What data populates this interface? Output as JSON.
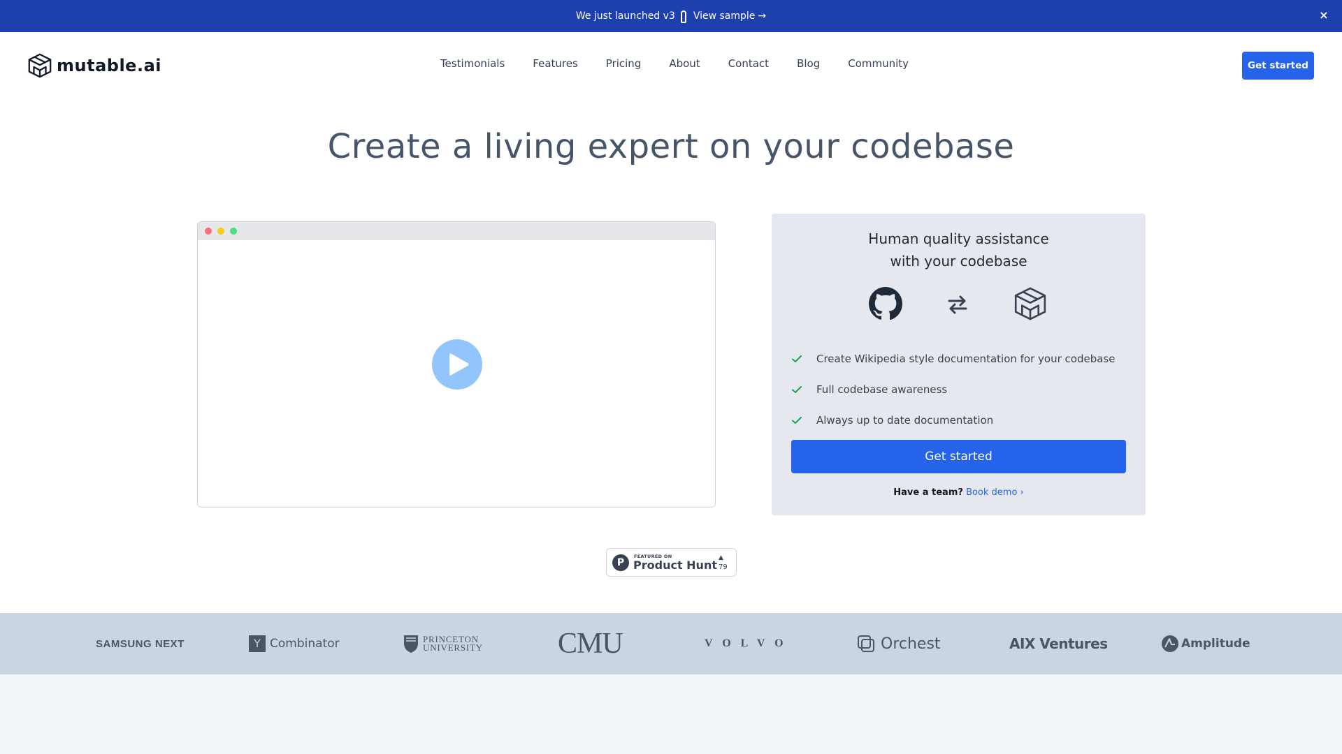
{
  "announcement": {
    "text": "We just launched v3",
    "link_label": "View sample",
    "arrow": "→",
    "close_label": "×"
  },
  "header": {
    "brand": "mutable.ai",
    "nav": [
      {
        "label": "Testimonials"
      },
      {
        "label": "Features"
      },
      {
        "label": "Pricing"
      },
      {
        "label": "About"
      },
      {
        "label": "Contact"
      },
      {
        "label": "Blog"
      },
      {
        "label": "Community"
      }
    ],
    "cta_label": "Get started"
  },
  "hero": {
    "title": "Create a living expert on your codebase"
  },
  "card": {
    "title_line1": "Human quality assistance",
    "title_line2": "with your codebase",
    "features": [
      "Create Wikipedia style documentation for your codebase",
      "Full codebase awareness",
      "Always up to date documentation"
    ],
    "cta_label": "Get started",
    "team_prefix": "Have a team?",
    "team_link": "Book demo ›"
  },
  "product_hunt": {
    "featured": "FEATURED ON",
    "name": "Product Hunt",
    "icon_letter": "P",
    "upvote_icon": "▲",
    "count": "79"
  },
  "logos": {
    "samsung": "SAMSUNG NEXT",
    "yc_box": "Y",
    "yc_text": "Combinator",
    "princeton_line1": "PRINCETON",
    "princeton_line2": "UNIVERSITY",
    "cmu": "CMU",
    "volvo": "VOLVO",
    "orchest": "Orchest",
    "aix": "AIX Ventures",
    "amplitude": "Amplitude"
  },
  "colors": {
    "announcement_bg": "#1e40af",
    "primary": "#2563eb",
    "heading": "#475569",
    "card_bg": "#e5e9ef",
    "band_bg": "#cbd5e1",
    "check": "#16a34a",
    "play": "#93c5fd",
    "dot_red": "#f87171",
    "dot_yellow": "#facc15",
    "dot_green": "#4ade80"
  },
  "icons": {
    "rocket": "rocket-icon",
    "close": "close-icon",
    "logo": "mutable-cube-icon",
    "github": "github-icon",
    "swap": "swap-arrows-icon",
    "check": "check-icon",
    "play": "play-icon"
  }
}
